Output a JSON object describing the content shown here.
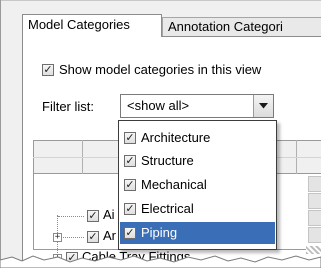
{
  "tabs": [
    {
      "label": "Model Categories",
      "active": true
    },
    {
      "label": "Annotation Categori",
      "active": false
    }
  ],
  "show_checkbox": {
    "label": "Show model categories in this view",
    "checked": true,
    "mark": "✓"
  },
  "filter": {
    "label": "Filter list:",
    "selected": "<show all>",
    "options": [
      {
        "label": "Architecture",
        "checked": true,
        "mark": "✓"
      },
      {
        "label": "Structure",
        "checked": true,
        "mark": "✓"
      },
      {
        "label": "Mechanical",
        "checked": true,
        "mark": "✓"
      },
      {
        "label": "Electrical",
        "checked": true,
        "mark": "✓"
      },
      {
        "label": "Piping",
        "checked": true,
        "mark": "✓",
        "highlighted": true
      }
    ]
  },
  "tree": {
    "rows": [
      {
        "label": "Ai",
        "checked": true,
        "mark": "✓",
        "expander": ""
      },
      {
        "label": "Ar",
        "checked": true,
        "mark": "✓",
        "expander": "+"
      },
      {
        "label": "Cable Tray Fittings",
        "checked": true,
        "mark": "✓",
        "expander": "+"
      }
    ]
  },
  "colors": {
    "selection": "#3a6fb8",
    "dialog_bg": "#f0f0f0"
  }
}
